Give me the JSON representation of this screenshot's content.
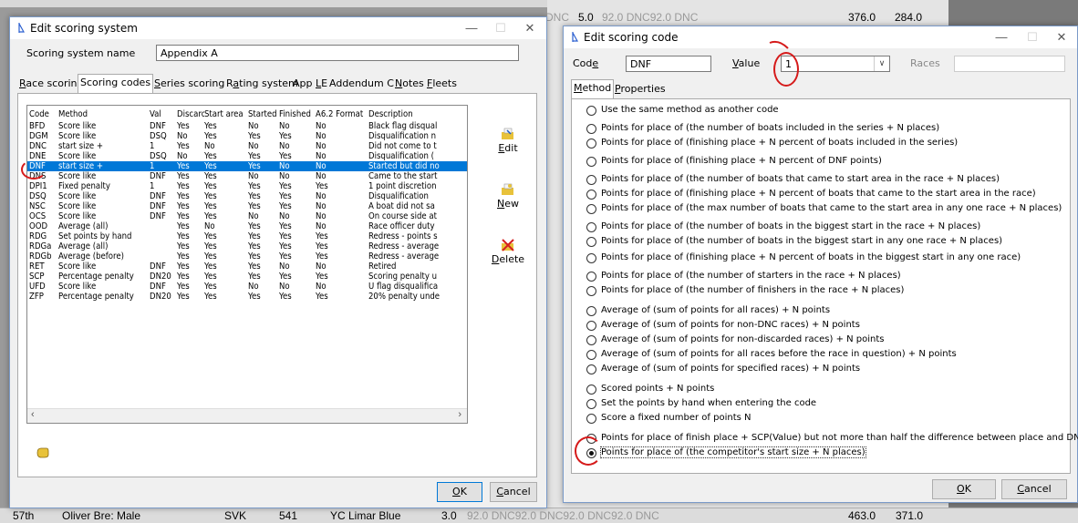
{
  "background": {
    "top_row_right": {
      "dnc": "DNC",
      "v1": "5.0",
      "v2": "92.0 DNC92.0 DNC",
      "v3": "376.0",
      "v4": "284.0"
    },
    "bottom_row": {
      "place": "57th",
      "name": "Oliver Bre: Male",
      "nat": "SVK",
      "sail": "541",
      "club": "YC Limar Blue",
      "score": "3.0",
      "dnc": "92.0 DNC92.0 DNC92.0 DNC92.0 DNC",
      "total": "463.0",
      "net": "371.0"
    }
  },
  "left_window": {
    "title": "Edit scoring system",
    "system_name_label": "Scoring system name",
    "system_name_value": "Appendix A",
    "tabs": [
      "Race scoring",
      "Scoring codes",
      "Series scoring",
      "Rating system",
      "App LE",
      "Addendum C",
      "Notes",
      "Fleets"
    ],
    "active_tab": "Scoring codes",
    "columns": [
      "Code",
      "Method",
      "Val",
      "Discard",
      "Start area",
      "Started",
      "Finished",
      "A6.2 Format",
      "Description"
    ],
    "rows": [
      [
        "BFD",
        "Score like",
        "DNF",
        "Yes",
        "Yes",
        "No",
        "No",
        "No",
        "Black flag disqual"
      ],
      [
        "DGM",
        "Score like",
        "DSQ",
        "No",
        "Yes",
        "Yes",
        "Yes",
        "No",
        "Disqualification n"
      ],
      [
        "DNC",
        "start size +",
        "1",
        "Yes",
        "No",
        "No",
        "No",
        "No",
        "Did not come to t"
      ],
      [
        "DNE",
        "Score like",
        "DSQ",
        "No",
        "Yes",
        "Yes",
        "Yes",
        "No",
        "Disqualification ("
      ],
      [
        "DNF",
        "start size +",
        "1",
        "Yes",
        "Yes",
        "Yes",
        "No",
        "No",
        "Started but did no"
      ],
      [
        "DNS",
        "Score like",
        "DNF",
        "Yes",
        "Yes",
        "No",
        "No",
        "No",
        "Came to the start"
      ],
      [
        "DPI1",
        "Fixed penalty",
        "1",
        "Yes",
        "Yes",
        "Yes",
        "Yes",
        "Yes",
        "1 point discretion"
      ],
      [
        "DSQ",
        "Score like",
        "DNF",
        "Yes",
        "Yes",
        "Yes",
        "Yes",
        "No",
        "Disqualification"
      ],
      [
        "NSC",
        "Score like",
        "DNF",
        "Yes",
        "Yes",
        "Yes",
        "Yes",
        "No",
        "A boat did not sa"
      ],
      [
        "OCS",
        "Score like",
        "DNF",
        "Yes",
        "Yes",
        "No",
        "No",
        "No",
        "On course side at"
      ],
      [
        "OOD",
        "Average (all)",
        "",
        "Yes",
        "No",
        "Yes",
        "Yes",
        "No",
        "Race officer duty"
      ],
      [
        "RDG",
        "Set points by hand",
        "",
        "Yes",
        "Yes",
        "Yes",
        "Yes",
        "Yes",
        "Redress - points s"
      ],
      [
        "RDGa",
        "Average (all)",
        "",
        "Yes",
        "Yes",
        "Yes",
        "Yes",
        "Yes",
        "Redress - average"
      ],
      [
        "RDGb",
        "Average (before)",
        "",
        "Yes",
        "Yes",
        "Yes",
        "Yes",
        "Yes",
        "Redress - average"
      ],
      [
        "RET",
        "Score like",
        "DNF",
        "Yes",
        "Yes",
        "Yes",
        "No",
        "No",
        "Retired"
      ],
      [
        "SCP",
        "Percentage penalty",
        "DN20",
        "Yes",
        "Yes",
        "Yes",
        "Yes",
        "Yes",
        "Scoring penalty u"
      ],
      [
        "UFD",
        "Score like",
        "DNF",
        "Yes",
        "Yes",
        "No",
        "No",
        "No",
        "U flag disqualifica"
      ],
      [
        "ZFP",
        "Percentage penalty",
        "DN20",
        "Yes",
        "Yes",
        "Yes",
        "Yes",
        "Yes",
        "20% penalty unde"
      ]
    ],
    "selected_code": "DNF",
    "edit_label": "Edit",
    "new_label": "New",
    "delete_label": "Delete",
    "ok_label": "OK",
    "cancel_label": "Cancel"
  },
  "right_window": {
    "title": "Edit scoring code",
    "code_label": "Code",
    "code_value": "DNF",
    "value_label": "Value",
    "value_value": "1",
    "races_label": "Races",
    "races_value": "",
    "tabs": [
      "Method",
      "Properties"
    ],
    "active_tab": "Method",
    "options": [
      "Use the same method as another code",
      "Points for place of (the number of boats included in the series + N places)",
      "Points for place of (finishing place + N percent of boats included in the series)",
      "Points for place of (finishing place + N percent of DNF points)",
      "Points for place of (the number of boats that came to start area in the race + N places)",
      "Points for place of (finishing place + N percent of boats that came to the start area in the race)",
      "Points for place of (the max number of boats that came to the start area in any one race + N places)",
      "Points for place of (the number of boats in the biggest start in the race + N places)",
      "Points for place of (the number of boats in the biggest start in any one race + N places)",
      "Points for place of (finishing place + N percent of boats in the biggest start in any one race)",
      "Points for place of (the number of starters in the race + N places)",
      "Points for place of (the number of finishers in the race + N places)",
      "Average of (sum of points for all races) + N points",
      "Average of (sum of points for non-DNC races) + N points",
      "Average of (sum of points for non-discarded races) + N points",
      "Average of (sum of points for all races before the race in question) + N points",
      "Average of (sum of points for specified races) + N points",
      "Scored points + N points",
      "Set the points by hand when entering the code",
      "Score a fixed number of points N",
      "Points for place of finish place + SCP(Value) but not more than half the difference between place and DNF",
      "Points for place of (the competitor's start size + N places)"
    ],
    "selected_option_index": 21,
    "ok_label": "OK",
    "cancel_label": "Cancel"
  },
  "colors": {
    "selection": "#0078d7",
    "annotation": "#d51a1a"
  }
}
